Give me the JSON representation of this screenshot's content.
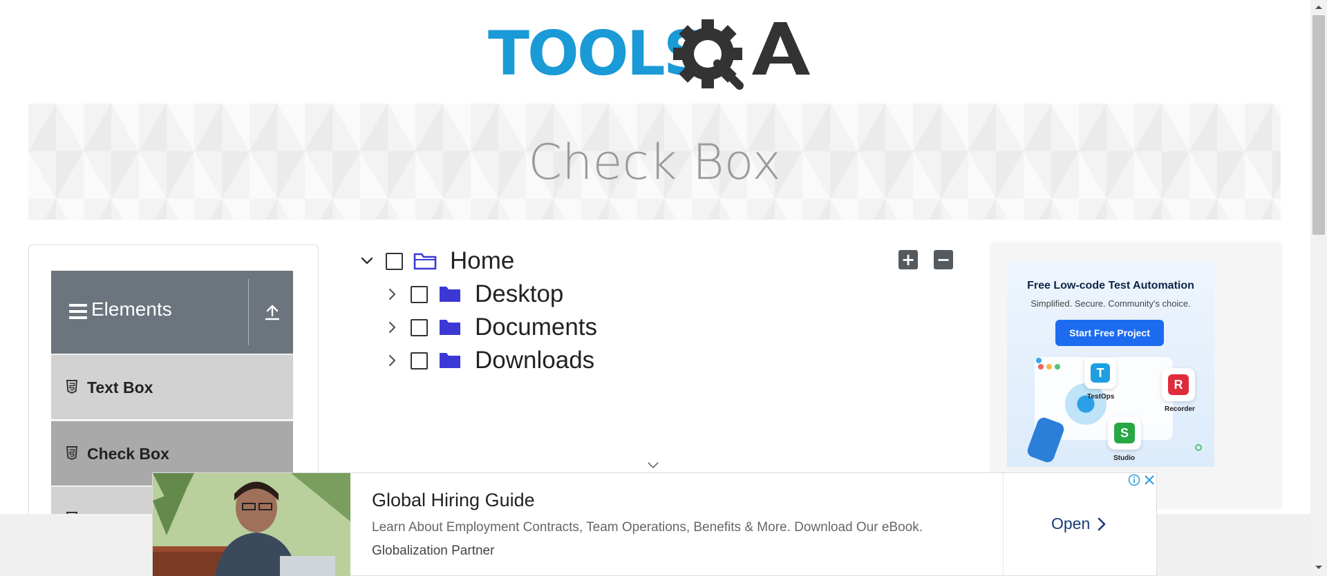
{
  "header": {
    "logo_text": "TOOLSQA"
  },
  "banner": {
    "title": "Check Box"
  },
  "sidebar": {
    "group": {
      "title": "Elements"
    },
    "items": [
      {
        "label": "Text Box"
      },
      {
        "label": "Check Box"
      },
      {
        "label": ""
      }
    ]
  },
  "tree": {
    "nodes": [
      {
        "label": "Home",
        "expanded": true
      },
      {
        "label": "Desktop",
        "expanded": false
      },
      {
        "label": "Documents",
        "expanded": false
      },
      {
        "label": "Downloads",
        "expanded": false
      }
    ],
    "expand_all_label": "+",
    "collapse_all_label": "−"
  },
  "side_ad": {
    "headline": "Free Low-code Test Automation",
    "subline": "Simplified. Secure. Community's choice.",
    "cta": "Start Free Project",
    "tiles": [
      {
        "letter": "T",
        "label": "TestOps",
        "color": "#1f9fe3"
      },
      {
        "letter": "R",
        "label": "Recorder",
        "color": "#e02b3c"
      },
      {
        "letter": "S",
        "label": "Studio",
        "color": "#28a745"
      }
    ]
  },
  "bottom_ad": {
    "title": "Global Hiring Guide",
    "description": "Learn About Employment Contracts, Team Operations, Benefits & More. Download Our eBook.",
    "sponsor": "Globalization Partner",
    "cta": "Open"
  },
  "colors": {
    "logo_blue": "#1a9ad6",
    "logo_dark": "#333333",
    "menu_header": "#6c757d",
    "menu_item": "#d2d2d2",
    "menu_item_active": "#a9a9a9",
    "folder_blue": "#3b38d6"
  }
}
